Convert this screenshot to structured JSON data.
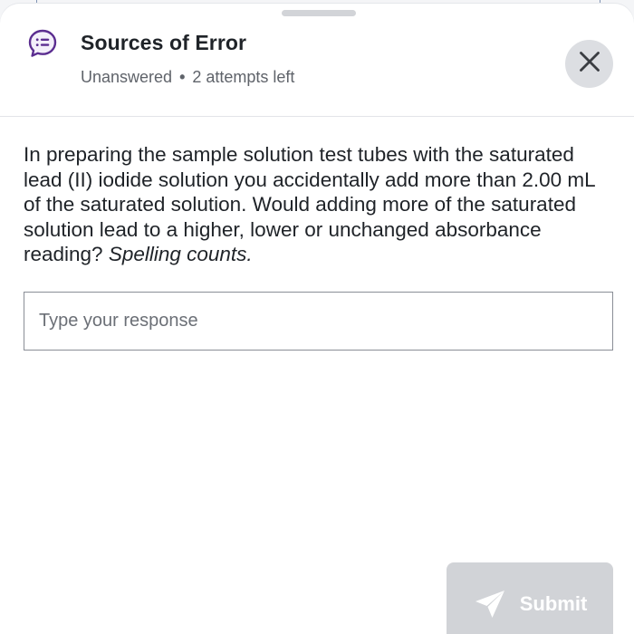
{
  "header": {
    "title": "Sources of Error",
    "status": "Unanswered",
    "separator": "•",
    "attempts": "2 attempts left",
    "icon": "question-list-icon",
    "accent_color": "#5b2d90"
  },
  "question": {
    "text": "In preparing the sample solution test tubes with the saturated lead (II) iodide solution you accidentally add more than 2.00 mL of the saturated solution.  Would adding more of the saturated solution lead to a higher, lower or unchanged absorbance reading? ",
    "note": "Spelling counts."
  },
  "response": {
    "placeholder": "Type your response",
    "value": ""
  },
  "actions": {
    "close_icon": "close-icon",
    "submit_label": "Submit",
    "submit_icon": "send-icon",
    "submit_enabled": false
  }
}
